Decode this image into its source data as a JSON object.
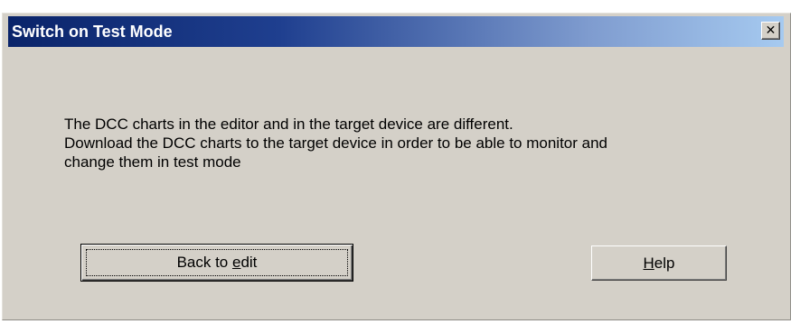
{
  "window": {
    "title": "Switch on Test Mode",
    "close_glyph": "✕"
  },
  "message": {
    "lines": [
      "The DCC charts in the editor and in the target device are different.",
      "Download the DCC charts to the target device in order to be able to monitor and",
      "change them in test mode"
    ]
  },
  "buttons": {
    "back_to_edit": {
      "label_before": "Back to ",
      "label_mnemonic": "e",
      "label_after": "dit"
    },
    "help": {
      "label_before": "",
      "label_mnemonic": "H",
      "label_after": "elp"
    }
  },
  "colors": {
    "dialog_face": "#d4d0c8",
    "titlebar_start": "#0a246a",
    "titlebar_end": "#a6caf0",
    "title_text": "#ffffff"
  }
}
